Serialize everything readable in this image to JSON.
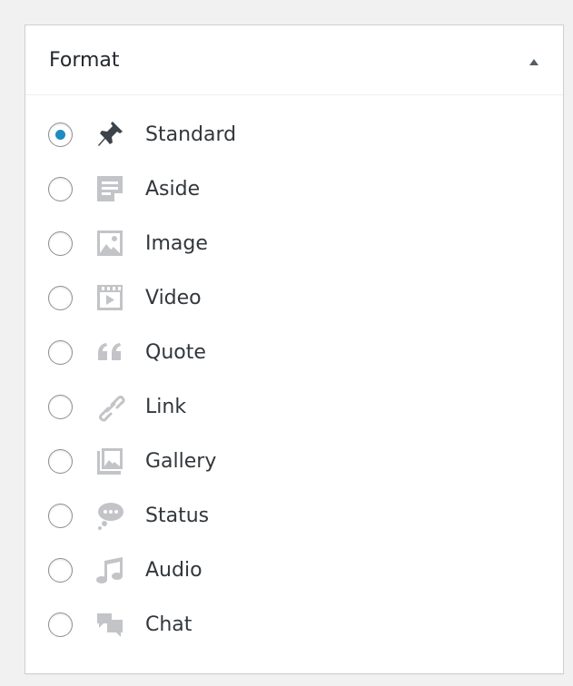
{
  "panel": {
    "title": "Format",
    "toggle_icon": "triangle-up-icon"
  },
  "formats": [
    {
      "label": "Standard",
      "icon": "pin-icon",
      "checked": true
    },
    {
      "label": "Aside",
      "icon": "aside-icon",
      "checked": false
    },
    {
      "label": "Image",
      "icon": "image-icon",
      "checked": false
    },
    {
      "label": "Video",
      "icon": "video-icon",
      "checked": false
    },
    {
      "label": "Quote",
      "icon": "quote-icon",
      "checked": false
    },
    {
      "label": "Link",
      "icon": "link-icon",
      "checked": false
    },
    {
      "label": "Gallery",
      "icon": "gallery-icon",
      "checked": false
    },
    {
      "label": "Status",
      "icon": "status-icon",
      "checked": false
    },
    {
      "label": "Audio",
      "icon": "audio-icon",
      "checked": false
    },
    {
      "label": "Chat",
      "icon": "chat-icon",
      "checked": false
    }
  ],
  "colors": {
    "accent": "#1e8cbe",
    "icon_muted": "#c3c4c7",
    "icon_active": "#3c434a"
  }
}
